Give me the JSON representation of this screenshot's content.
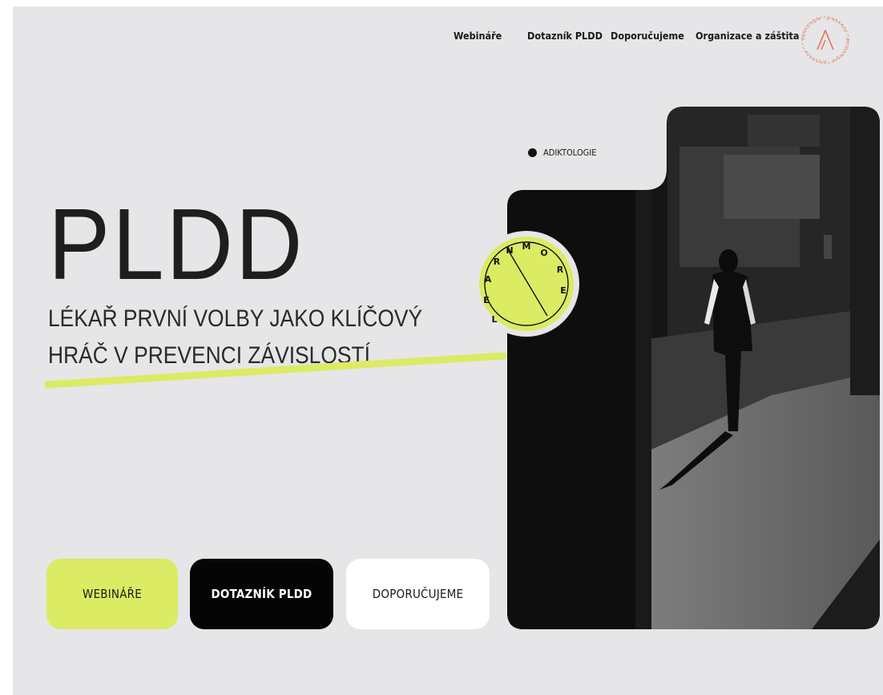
{
  "nav": {
    "items": [
      "Webináře",
      "Dotazník PLDD",
      "Doporučujeme",
      "Organizace a záštita"
    ]
  },
  "logo": {
    "icon": "a-triangle-icon",
    "ring_text": "Adiktologie · prevence · Adiktologie · prevence ·"
  },
  "hero": {
    "title": "PLDD",
    "subtitle_line1": "Lékař první volby jako klíčový",
    "subtitle_line2": "hráč v prevenci závislostí"
  },
  "tag": {
    "label": "ADIKTOLOGIE"
  },
  "badge": {
    "letters": "LEARNMORE"
  },
  "buttons": {
    "webinare": "WEBINÁŘE",
    "dotaznik": "DOTAZNÍK PLDD",
    "doporucujeme": "DOPORUČUJEME"
  },
  "colors": {
    "accent": "#dbeb63",
    "background": "#e6e6e8",
    "logo": "#e4735d",
    "dark": "#050505"
  }
}
